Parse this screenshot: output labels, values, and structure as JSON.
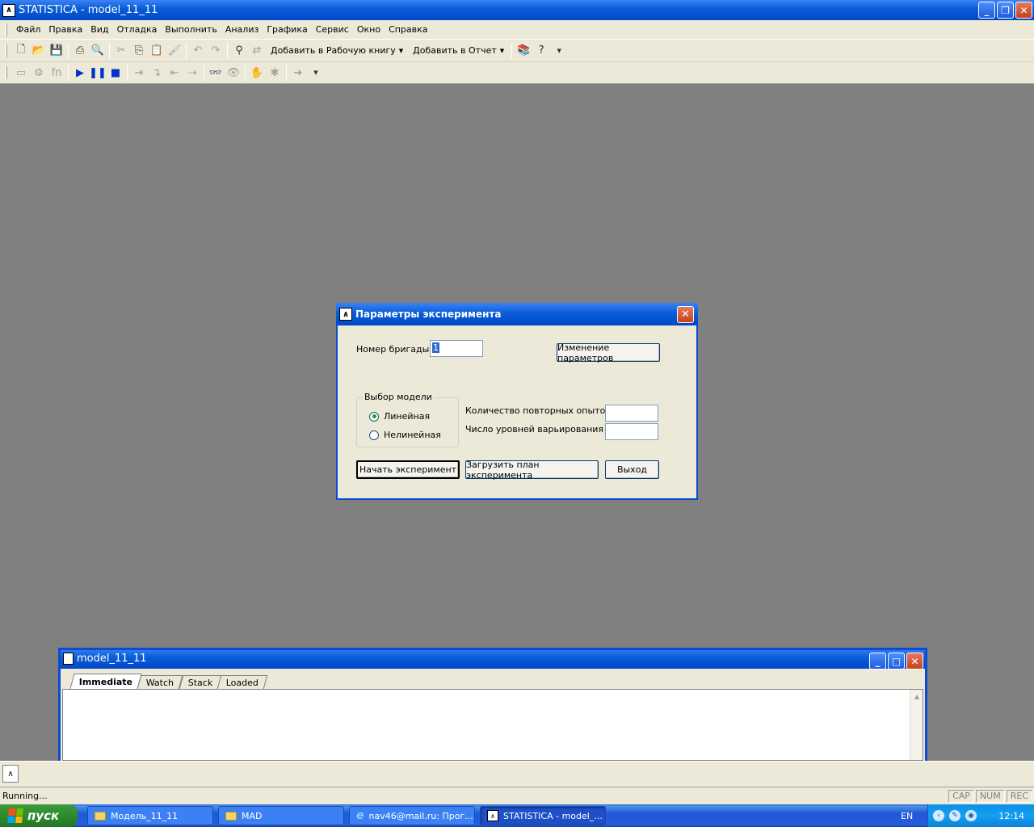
{
  "window": {
    "title": "STATISTICA - model_11_11"
  },
  "menu": [
    "Файл",
    "Правка",
    "Вид",
    "Отладка",
    "Выполнить",
    "Анализ",
    "Графика",
    "Сервис",
    "Окно",
    "Справка"
  ],
  "toolbar": {
    "add_workbook": "Добавить в Рабочую книгу",
    "add_report": "Добавить в Отчет",
    "fn_label": "fn"
  },
  "dialog": {
    "title": "Параметры эксперимента",
    "brigade_label": "Номер бригады",
    "brigade_value": "1",
    "change_params": "Изменение параметров",
    "model_group": "Выбор модели",
    "model_options": [
      {
        "label": "Линейная",
        "selected": true
      },
      {
        "label": "Нелинейная",
        "selected": false
      }
    ],
    "repeat_label": "Количество повторных опытов",
    "repeat_value": "",
    "levels_label": "Число уровней варьирования",
    "levels_value": "",
    "start_button": "Начать эксперимент",
    "load_button": "Загрузить план эксперимента",
    "exit_button": "Выход"
  },
  "debug_window": {
    "title": "model_11_11",
    "tabs": [
      "Immediate",
      "Watch",
      "Stack",
      "Loaded"
    ],
    "active_tab": "Immediate"
  },
  "status": {
    "text": "Running...",
    "indicators": [
      "CAP",
      "NUM",
      "REC"
    ]
  },
  "taskbar": {
    "start": "пуск",
    "tasks": [
      {
        "label": "Модель_11_11",
        "icon": "folder-icon",
        "active": false
      },
      {
        "label": "MAD",
        "icon": "folder-icon",
        "active": false
      },
      {
        "label": "nav46@mail.ru: Прог...",
        "icon": "ie-icon",
        "active": false
      },
      {
        "label": "STATISTICA - model_...",
        "icon": "statistica-icon",
        "active": true
      }
    ],
    "lang": "EN",
    "clock": "12:14"
  }
}
